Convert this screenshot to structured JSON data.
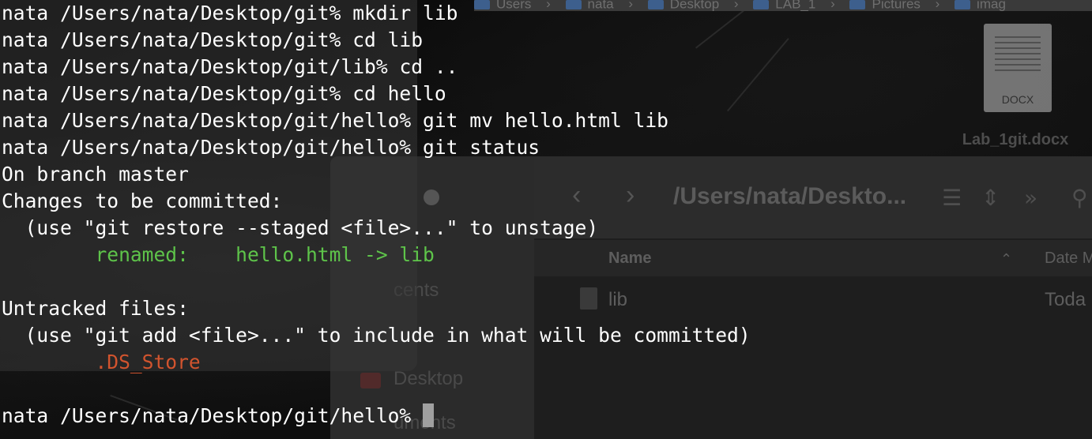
{
  "finder_path": [
    "Users",
    "nata",
    "Desktop",
    "LAB_1",
    "Pictures",
    "imag"
  ],
  "desktop_file": {
    "name": "Lab_1git.docx",
    "type_label": "DOCX"
  },
  "finder": {
    "title": "/Users/nata/Deskto...",
    "column_name": "Name",
    "column_date": "Date M",
    "files": [
      {
        "name": "lib",
        "date": "Toda"
      }
    ],
    "sidebar_partial": [
      "cents",
      "Desktop",
      "uments"
    ]
  },
  "terminal": {
    "lines": [
      {
        "prompt": "nata /Users/nata/Desktop/git% ",
        "command": "mkdir lib"
      },
      {
        "prompt": "nata /Users/nata/Desktop/git% ",
        "command": "cd lib"
      },
      {
        "prompt": "nata /Users/nata/Desktop/git/lib% ",
        "command": "cd .."
      },
      {
        "prompt": "nata /Users/nata/Desktop/git% ",
        "command": "cd hello"
      },
      {
        "prompt": "nata /Users/nata/Desktop/git/hello% ",
        "command": "git mv hello.html lib"
      },
      {
        "prompt": "nata /Users/nata/Desktop/git/hello% ",
        "command": "git status"
      }
    ],
    "status": {
      "branch_line": "On branch master",
      "staged_header": "Changes to be committed:",
      "staged_hint": "  (use \"git restore --staged <file>...\" to unstage)",
      "renamed_entry": "        renamed:    hello.html -> lib",
      "untracked_header": "Untracked files:",
      "untracked_hint": "  (use \"git add <file>...\" to include in what will be committed)",
      "untracked_entry": "        .DS_Store"
    },
    "final_prompt": "nata /Users/nata/Desktop/git/hello% ",
    "colors": {
      "text": "#ffffff",
      "staged": "#5ec44a",
      "untracked": "#d2542e"
    }
  }
}
